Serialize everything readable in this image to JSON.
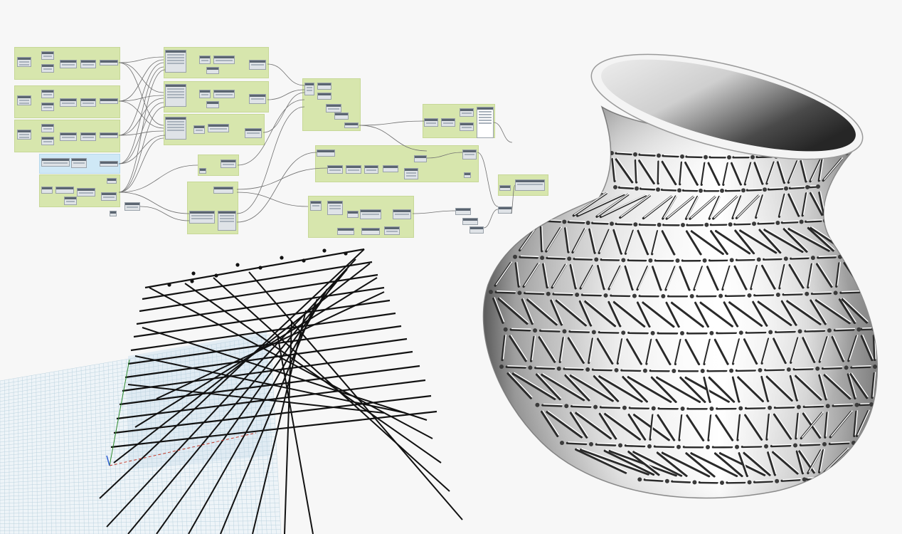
{
  "canvas": {
    "background": "#f7f7f7",
    "group_color": "#d7e6ad",
    "input_group_color": "#cfe8f6",
    "node_body_color": "#dfe3e7",
    "node_header_color": "#5b6571",
    "wire_color": "#6f6f6f"
  },
  "viewport": {
    "ground_grid_color": "#bcd3df",
    "line_color": "#111111",
    "axis_colors": [
      "#2e8b2e",
      "#c0392b",
      "#2f5fd1"
    ]
  },
  "model": {
    "surface": "vase-shell",
    "pattern": "triangular-panel-cutouts",
    "shade_light": "#ffffff",
    "shade_dark": "#6d6d6d"
  }
}
